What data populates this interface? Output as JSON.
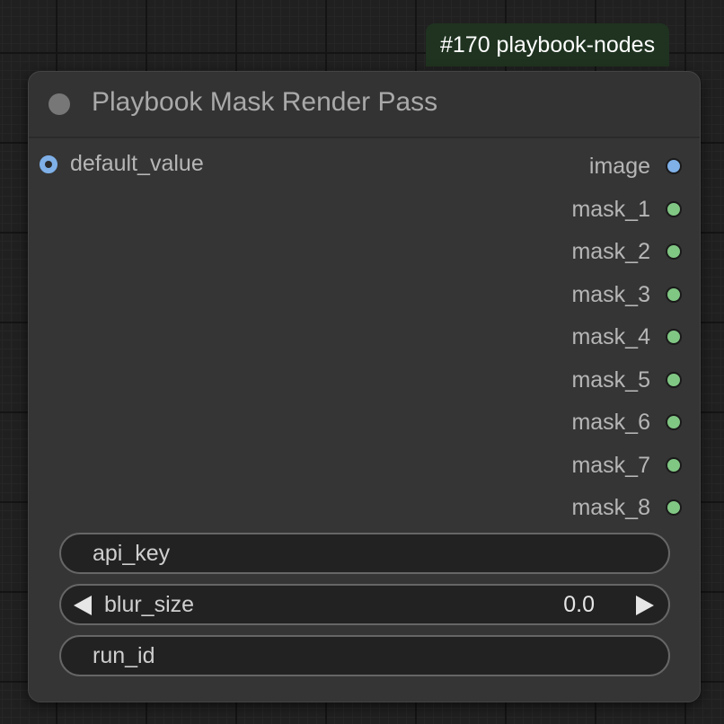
{
  "badge": {
    "text": "#170 playbook-nodes"
  },
  "node": {
    "title": "Playbook Mask Render Pass",
    "inputs": [
      {
        "label": "default_value",
        "color": "#7fb0e8"
      }
    ],
    "outputs": [
      {
        "label": "image",
        "color": "#7fb0e8"
      },
      {
        "label": "mask_1",
        "color": "#81c784"
      },
      {
        "label": "mask_2",
        "color": "#81c784"
      },
      {
        "label": "mask_3",
        "color": "#81c784"
      },
      {
        "label": "mask_4",
        "color": "#81c784"
      },
      {
        "label": "mask_5",
        "color": "#81c784"
      },
      {
        "label": "mask_6",
        "color": "#81c784"
      },
      {
        "label": "mask_7",
        "color": "#81c784"
      },
      {
        "label": "mask_8",
        "color": "#81c784"
      }
    ],
    "widgets": {
      "api_key": {
        "label": "api_key"
      },
      "blur_size": {
        "label": "blur_size",
        "value": "0.0"
      },
      "run_id": {
        "label": "run_id"
      }
    }
  }
}
